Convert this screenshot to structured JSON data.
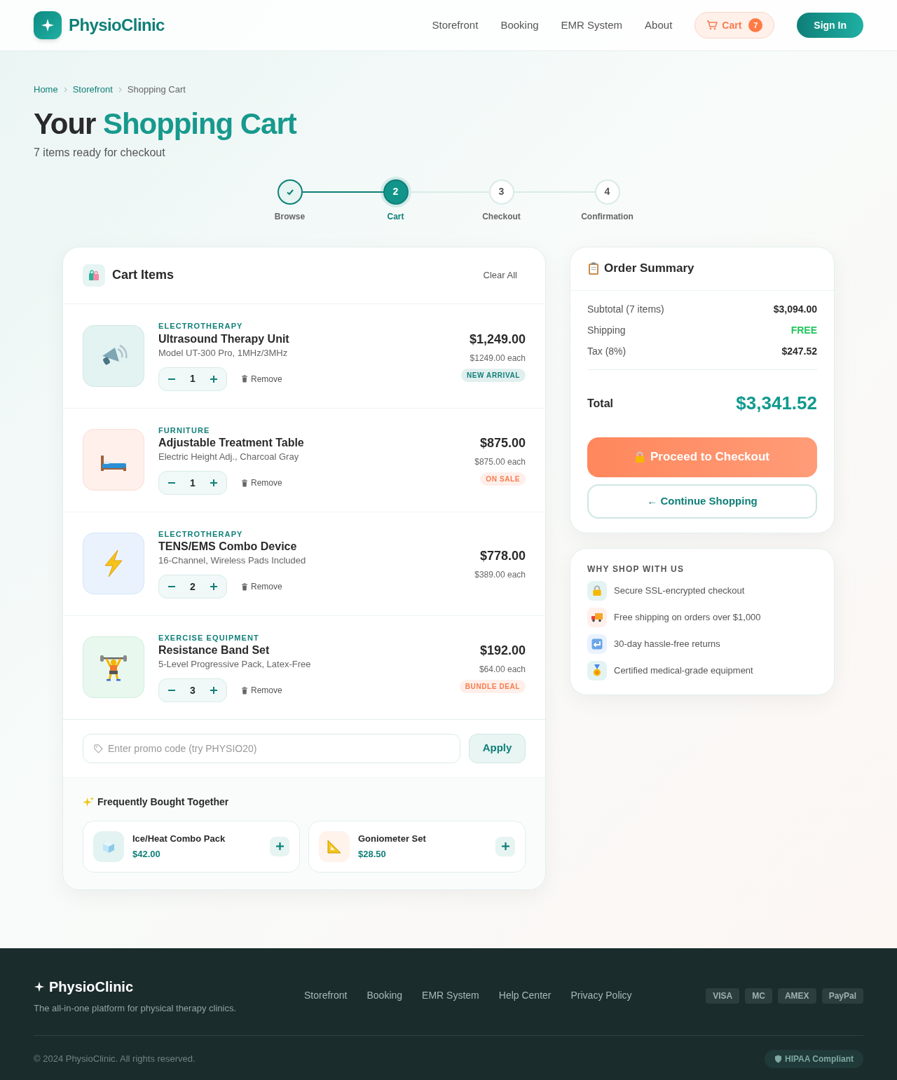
{
  "header": {
    "brand": "PhysioClinic",
    "nav": [
      {
        "label": "Storefront"
      },
      {
        "label": "Booking"
      },
      {
        "label": "EMR System"
      },
      {
        "label": "About"
      }
    ],
    "cart": {
      "label": "Cart",
      "count": "7"
    },
    "sign_in": "Sign In"
  },
  "breadcrumb": [
    {
      "label": "Home",
      "current": false
    },
    {
      "label": "Storefront",
      "current": false
    },
    {
      "label": "Shopping Cart",
      "current": true
    }
  ],
  "title": {
    "lead": "Your",
    "accent": "Shopping Cart"
  },
  "subtitle": "7 items ready for checkout",
  "steps": [
    {
      "label": "Browse",
      "completed": true,
      "selected": false
    },
    {
      "number": "2",
      "label": "Cart",
      "completed": false,
      "selected": true
    },
    {
      "number": "3",
      "label": "Checkout",
      "completed": false,
      "selected": false
    },
    {
      "number": "4",
      "label": "Confirmation",
      "completed": false,
      "selected": false
    }
  ],
  "cart_items": {
    "title": "Cart Items",
    "clear": "Clear All",
    "items": [
      {
        "category": "ELECTROTHERAPY",
        "name": "Ultrasound Therapy Unit",
        "description": "Model UT-300 Pro, 1MHz/3MHz",
        "quantity": "1",
        "remove": "Remove",
        "total": "$1,249.00",
        "each": "$1249.00 each",
        "badge": {
          "label": "NEW ARRIVAL",
          "color": "#0f7f78"
        }
      },
      {
        "category": "FURNITURE",
        "name": "Adjustable Treatment Table",
        "description": "Electric Height Adj., Charcoal Gray",
        "quantity": "1",
        "remove": "Remove",
        "total": "$875.00",
        "each": "$875.00 each",
        "badge": {
          "label": "ON SALE",
          "color": "#f97b4f"
        }
      },
      {
        "category": "ELECTROTHERAPY",
        "name": "TENS/EMS Combo Device",
        "description": "16-Channel, Wireless Pads Included",
        "quantity": "2",
        "remove": "Remove",
        "total": "$778.00",
        "each": "$389.00 each"
      },
      {
        "category": "EXERCISE EQUIPMENT",
        "name": "Resistance Band Set",
        "description": "5-Level Progressive Pack, Latex-Free",
        "quantity": "3",
        "remove": "Remove",
        "total": "$192.00",
        "each": "$64.00 each",
        "badge": {
          "label": "BUNDLE DEAL",
          "color": "#f97b4f"
        }
      }
    ],
    "promo": {
      "placeholder": "Enter promo code (try PHYSIO20)",
      "apply": "Apply"
    },
    "bundle": {
      "title": "Frequently Bought Together",
      "items": [
        {
          "name": "Ice/Heat Combo Pack",
          "price": "$42.00"
        },
        {
          "name": "Goniometer Set",
          "price": "$28.50"
        }
      ]
    }
  },
  "summary": {
    "title": "Order Summary",
    "rows": [
      {
        "label": "Subtotal (7 items)",
        "value": "$3,094.00",
        "kind": "normal"
      },
      {
        "label": "Shipping",
        "value": "FREE",
        "kind": "free"
      },
      {
        "label": "Tax (8%)",
        "value": "$247.52",
        "kind": "normal"
      }
    ],
    "total_label": "Total",
    "total": "$3,341.52",
    "checkout": "Proceed to Checkout",
    "continue": "← Continue Shopping"
  },
  "why": {
    "title": "WHY SHOP WITH US",
    "items": [
      "Secure SSL-encrypted checkout",
      "Free shipping on orders over $1,000",
      "30-day hassle-free returns",
      "Certified medical-grade equipment"
    ]
  },
  "footer": {
    "brand": "PhysioClinic",
    "tagline": "The all-in-one platform for physical therapy clinics.",
    "links": [
      "Storefront",
      "Booking",
      "EMR System",
      "Help Center",
      "Privacy Policy"
    ],
    "payments": [
      "VISA",
      "MC",
      "AMEX",
      "PayPal"
    ],
    "copyright": "© 2024 PhysioClinic. All rights reserved.",
    "badge": "HIPAA Compliant"
  }
}
